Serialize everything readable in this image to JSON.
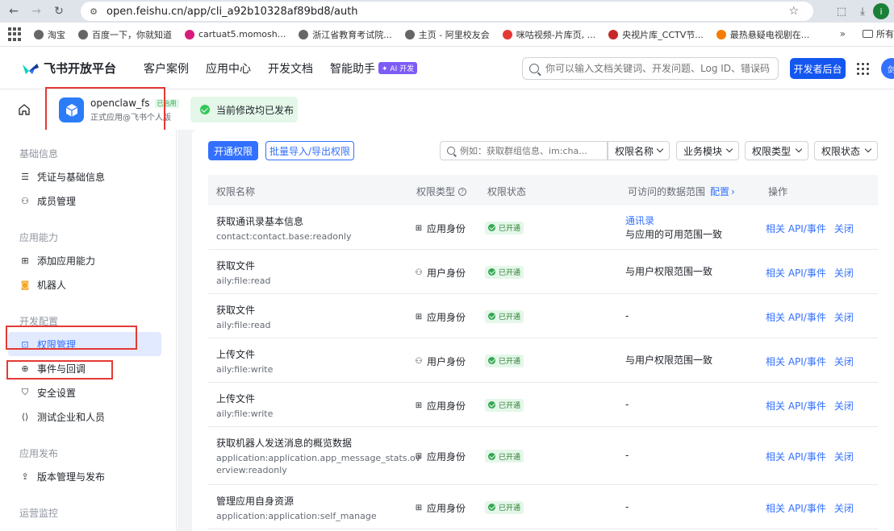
{
  "browser": {
    "url": "open.feishu.cn/app/cli_a92b10328af89bd8/auth",
    "profile_initial": "i",
    "bookmarks": [
      {
        "label": "淘宝",
        "color": "#666666"
      },
      {
        "label": "百度一下，你就知道",
        "color": "#666666"
      },
      {
        "label": "cartuat5.momosh...",
        "color": "#d81b7a"
      },
      {
        "label": "浙江省教育考试院...",
        "color": "#666666"
      },
      {
        "label": "主页 - 阿里校友会",
        "color": "#666666"
      },
      {
        "label": "咪咕视频-片库页, ...",
        "color": "#e53935"
      },
      {
        "label": "央视片库_CCTV节...",
        "color": "#c62828"
      },
      {
        "label": "最热悬疑电视剧在...",
        "color": "#f57c00"
      }
    ],
    "bookmarks_more": "»",
    "bookmarks_folder": "所有"
  },
  "header": {
    "logo_text": "飞书开放平台",
    "nav": [
      "客户案例",
      "应用中心",
      "开发文档",
      "智能助手"
    ],
    "ai_badge": "✦ AI 开发",
    "search_placeholder": "你可以输入文档关键词、开发问题、Log ID、错误码",
    "dev_button": "开发者后台",
    "avatar_text": "剑"
  },
  "app": {
    "name": "openclaw_fs",
    "tag": "已启用",
    "subtitle": "正式应用@飞书个人版",
    "publish_status": "当前修改均已发布"
  },
  "sidebar": {
    "groups": [
      {
        "title": "基础信息",
        "items": [
          {
            "label": "凭证与基础信息",
            "icon": "doc-icon"
          },
          {
            "label": "成员管理",
            "icon": "user-plus-icon"
          }
        ]
      },
      {
        "title": "应用能力",
        "items": [
          {
            "label": "添加应用能力",
            "icon": "grid-plus-icon"
          },
          {
            "label": "机器人",
            "icon": "robot-icon"
          }
        ]
      },
      {
        "title": "开发配置",
        "items": [
          {
            "label": "权限管理",
            "icon": "permission-icon",
            "active": true
          },
          {
            "label": "事件与回调",
            "icon": "event-icon"
          },
          {
            "label": "安全设置",
            "icon": "shield-icon"
          },
          {
            "label": "测试企业和人员",
            "icon": "code-icon"
          }
        ]
      },
      {
        "title": "应用发布",
        "items": [
          {
            "label": "版本管理与发布",
            "icon": "upload-icon"
          }
        ]
      },
      {
        "title": "运营监控",
        "items": []
      }
    ]
  },
  "toolbar": {
    "open_permission": "开通权限",
    "batch_import": "批量导入/导出权限",
    "filter_placeholder": "例如：获取群组信息、im:cha...",
    "filters": [
      "权限名称",
      "业务模块",
      "权限类型",
      "权限状态"
    ]
  },
  "table": {
    "columns": [
      "权限名称",
      "权限类型",
      "权限状态",
      "可访问的数据范围",
      "操作"
    ],
    "configure_link": "配置",
    "rows": [
      {
        "name": "获取通讯录基本信息",
        "code": [
          "contact:contact.base:readonly"
        ],
        "type": "应用身份",
        "type_icon": "app-identity-icon",
        "status": "已开通",
        "scope_link": "通讯录",
        "scope": "与应用的可用范围一致",
        "ops": [
          "相关 API/事件",
          "关闭"
        ]
      },
      {
        "name": "获取文件",
        "code": [
          "aily:file:read"
        ],
        "type": "用户身份",
        "type_icon": "user-identity-icon",
        "status": "已开通",
        "scope_link": "",
        "scope": "与用户权限范围一致",
        "ops": [
          "相关 API/事件",
          "关闭"
        ]
      },
      {
        "name": "获取文件",
        "code": [
          "aily:file:read"
        ],
        "type": "应用身份",
        "type_icon": "app-identity-icon",
        "status": "已开通",
        "scope_link": "",
        "scope": "-",
        "ops": [
          "相关 API/事件",
          "关闭"
        ]
      },
      {
        "name": "上传文件",
        "code": [
          "aily:file:write"
        ],
        "type": "用户身份",
        "type_icon": "user-identity-icon",
        "status": "已开通",
        "scope_link": "",
        "scope": "与用户权限范围一致",
        "ops": [
          "相关 API/事件",
          "关闭"
        ]
      },
      {
        "name": "上传文件",
        "code": [
          "aily:file:write"
        ],
        "type": "应用身份",
        "type_icon": "app-identity-icon",
        "status": "已开通",
        "scope_link": "",
        "scope": "-",
        "ops": [
          "相关 API/事件",
          "关闭"
        ]
      },
      {
        "name": "获取机器人发送消息的概览数据",
        "code": [
          "application:application.app_message_stats.ov",
          "erview:readonly"
        ],
        "type": "应用身份",
        "type_icon": "app-identity-icon",
        "status": "已开通",
        "scope_link": "",
        "scope": "-",
        "ops": [
          "相关 API/事件",
          "关闭"
        ]
      },
      {
        "name": "管理应用自身资源",
        "code": [
          "application:application:self_manage"
        ],
        "type": "应用身份",
        "type_icon": "app-identity-icon",
        "status": "已开通",
        "scope_link": "",
        "scope": "-",
        "ops": [
          "相关 API/事件",
          "关闭"
        ]
      }
    ]
  },
  "colors": {
    "primary": "#3370ff",
    "success": "#34a853",
    "annotation_red": "#e53935"
  }
}
